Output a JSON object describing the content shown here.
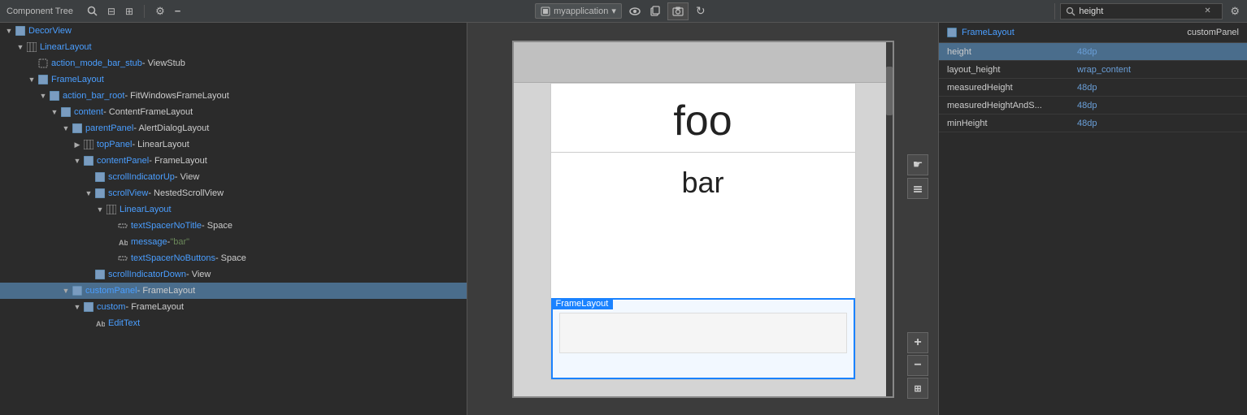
{
  "toolbar": {
    "component_tree_label": "Component Tree",
    "search_icon_label": "🔍",
    "align_icon_label": "⊟",
    "align2_icon_label": "⊞",
    "gear_icon_label": "⚙",
    "minus_icon_label": "−",
    "device_name": "myapplication",
    "eye_icon": "👁",
    "copy_icon": "⧉",
    "screenshot_icon": "📷",
    "refresh_icon": "↻",
    "search_placeholder": "height",
    "search_value": "height",
    "gear_right_icon": "⚙"
  },
  "tree": {
    "nodes": [
      {
        "indent": 0,
        "arrow": "▼",
        "icon": "framelayout",
        "name": "DecorView",
        "type": "",
        "value": ""
      },
      {
        "indent": 1,
        "arrow": "▼",
        "icon": "linearlayout",
        "name": "LinearLayout",
        "type": "",
        "value": ""
      },
      {
        "indent": 2,
        "arrow": "",
        "icon": "viewstub",
        "name": "action_mode_bar_stub",
        "type": " - ViewStub",
        "value": ""
      },
      {
        "indent": 2,
        "arrow": "▼",
        "icon": "framelayout",
        "name": "FrameLayout",
        "type": "",
        "value": ""
      },
      {
        "indent": 3,
        "arrow": "▼",
        "icon": "framelayout",
        "name": "action_bar_root",
        "type": " - FitWindowsFrameLayout",
        "value": ""
      },
      {
        "indent": 4,
        "arrow": "▼",
        "icon": "framelayout",
        "name": "content",
        "type": " - ContentFrameLayout",
        "value": ""
      },
      {
        "indent": 5,
        "arrow": "▼",
        "icon": "framelayout",
        "name": "parentPanel",
        "type": " - AlertDialogLayout",
        "value": ""
      },
      {
        "indent": 6,
        "arrow": "▶",
        "icon": "linearlayout",
        "name": "topPanel",
        "type": " - LinearLayout",
        "value": ""
      },
      {
        "indent": 6,
        "arrow": "▼",
        "icon": "framelayout",
        "name": "contentPanel",
        "type": " - FrameLayout",
        "value": ""
      },
      {
        "indent": 7,
        "arrow": "",
        "icon": "view",
        "name": "scrollIndicatorUp",
        "type": " - View",
        "value": ""
      },
      {
        "indent": 7,
        "arrow": "▼",
        "icon": "framelayout",
        "name": "scrollView",
        "type": " - NestedScrollView",
        "value": ""
      },
      {
        "indent": 8,
        "arrow": "▼",
        "icon": "linearlayout",
        "name": "LinearLayout",
        "type": "",
        "value": ""
      },
      {
        "indent": 9,
        "arrow": "",
        "icon": "space",
        "name": "textSpacerNoTitle",
        "type": " - Space",
        "value": ""
      },
      {
        "indent": 9,
        "arrow": "",
        "icon": "text",
        "name": "message",
        "type": " - ",
        "value": "\"bar\""
      },
      {
        "indent": 9,
        "arrow": "",
        "icon": "space",
        "name": "textSpacerNoButtons",
        "type": " - Space",
        "value": ""
      },
      {
        "indent": 7,
        "arrow": "",
        "icon": "view",
        "name": "scrollIndicatorDown",
        "type": " - View",
        "value": ""
      },
      {
        "indent": 5,
        "arrow": "▼",
        "icon": "framelayout",
        "name": "customPanel",
        "type": " - FrameLayout",
        "value": "",
        "selected": true
      },
      {
        "indent": 6,
        "arrow": "▼",
        "icon": "framelayout",
        "name": "custom",
        "type": " - FrameLayout",
        "value": ""
      },
      {
        "indent": 7,
        "arrow": "",
        "icon": "edittext",
        "name": "EditText",
        "type": "",
        "value": ""
      }
    ]
  },
  "properties": {
    "component_name": "FrameLayout",
    "component_panel": "customPanel",
    "rows": [
      {
        "name": "height",
        "value": "48dp",
        "selected": true
      },
      {
        "name": "layout_height",
        "value": "wrap_content"
      },
      {
        "name": "measuredHeight",
        "value": "48dp"
      },
      {
        "name": "measuredHeightAndS...",
        "value": "48dp"
      },
      {
        "name": "minHeight",
        "value": "48dp"
      }
    ]
  },
  "preview": {
    "text_foo": "foo",
    "text_bar": "bar",
    "frame_layout_label": "FrameLayout"
  }
}
